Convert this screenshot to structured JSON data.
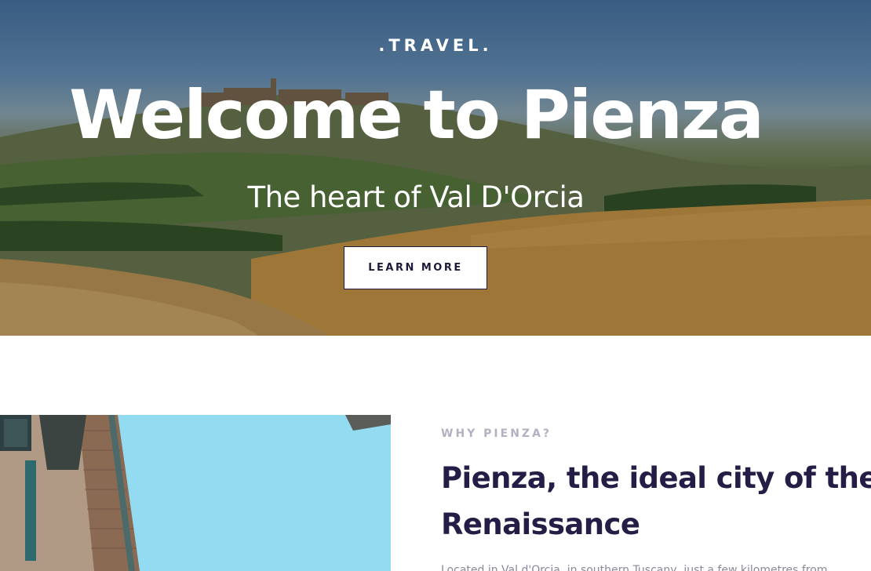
{
  "hero": {
    "tagline": ".TRAVEL.",
    "title": "Welcome to Pienza",
    "subtitle": "The heart of Val D'Orcia",
    "cta_label": "LEARN MORE"
  },
  "intro": {
    "eyebrow": "WHY PIENZA?",
    "title_line1": "Pienza, the ideal city of the",
    "title_line2": "Renaissance",
    "body": "Located in Val d'Orcia, in southern Tuscany, just a few kilometres from"
  },
  "colors": {
    "heading": "#251d45",
    "eyebrow": "#b3b0c2",
    "body": "#8a889a",
    "sky": "#93dbf1"
  }
}
